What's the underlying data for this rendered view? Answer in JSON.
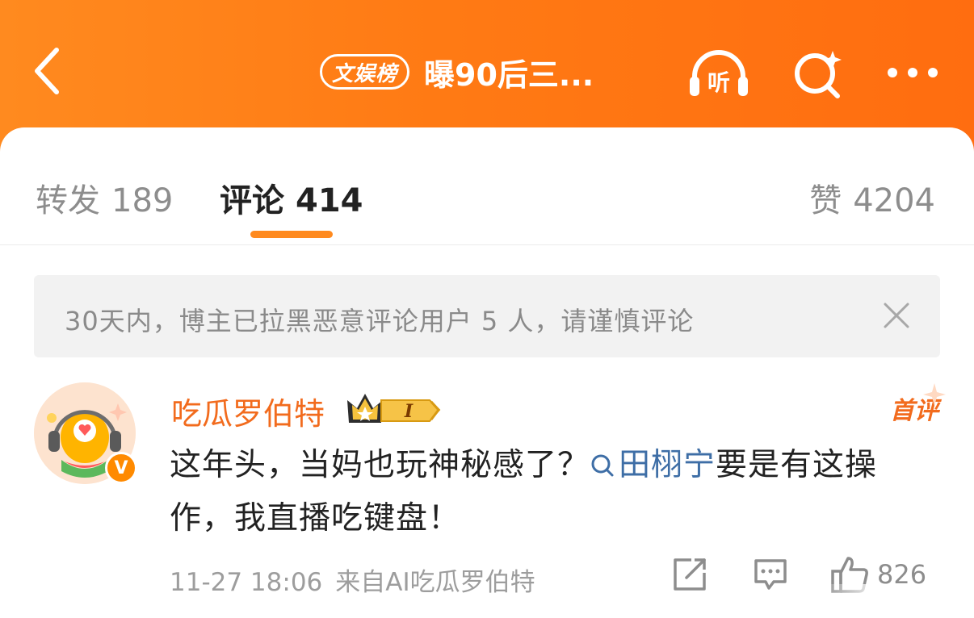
{
  "header": {
    "topic_badge": "文娱榜",
    "title": "曝90后三...",
    "icons": [
      "back-icon",
      "listen-icon",
      "search-icon",
      "more-icon"
    ],
    "listen_label": "听"
  },
  "tabs": {
    "repost_label": "转发",
    "repost_count": "189",
    "comment_label": "评论",
    "comment_count": "414",
    "like_label": "赞",
    "like_count": "4204",
    "active": "comment"
  },
  "notice": {
    "text": "30天内，博主已拉黑恶意评论用户 5 人，请谨慎评论"
  },
  "comment": {
    "username": "吃瓜罗伯特",
    "level": "I",
    "first_tag": "首评",
    "text_before": "这年头，当妈也玩神秘感了？",
    "mention": "田栩宁",
    "text_after": "要是有这操作，我直播吃键盘！",
    "time": "11-27 18:06",
    "source": "来自AI吃瓜罗伯特",
    "like_count": "826",
    "verified": "V"
  },
  "colors": {
    "header_orange": "#ff7a14",
    "accent_orange": "#f26b1d",
    "mention_blue": "#3e6ea6"
  }
}
